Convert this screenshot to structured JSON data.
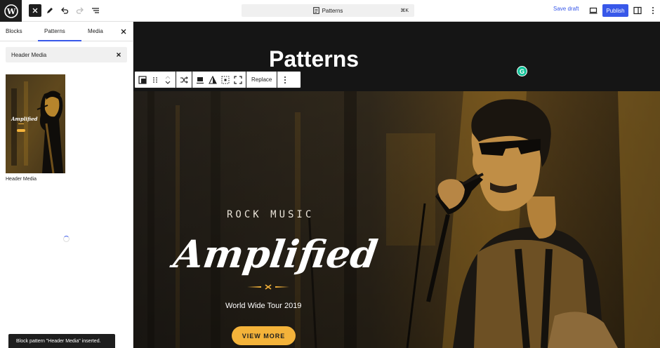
{
  "topbar": {
    "command_title": "Patterns",
    "command_shortcut": "⌘K",
    "save_draft": "Save draft",
    "publish": "Publish"
  },
  "sidebar": {
    "tabs": [
      "Blocks",
      "Patterns",
      "Media"
    ],
    "active_tab": "Patterns",
    "search_value": "Header Media",
    "pattern": {
      "label": "Header Media",
      "thumb_title": "Amplified"
    }
  },
  "canvas": {
    "page_title": "Patterns",
    "toolbar": {
      "replace_label": "Replace"
    },
    "hero": {
      "subtitle": "ROCK MUSIC",
      "title": "Amplified",
      "tour": "World Wide Tour 2019",
      "button": "VIEW MORE"
    }
  },
  "snackbar": "Block pattern \"Header Media\" inserted.",
  "colors": {
    "accent": "#3858e9",
    "hero_button": "#f4b33a",
    "canvas_bg": "#151515",
    "grammarly": "#15c39a"
  },
  "icons": {
    "logo": "wordpress-logo-icon",
    "tools": [
      "close-icon",
      "pencil-icon",
      "undo-icon",
      "redo-icon",
      "list-view-icon"
    ],
    "right": [
      "desktop-view-icon",
      "sidebar-settings-icon",
      "more-options-icon"
    ]
  }
}
